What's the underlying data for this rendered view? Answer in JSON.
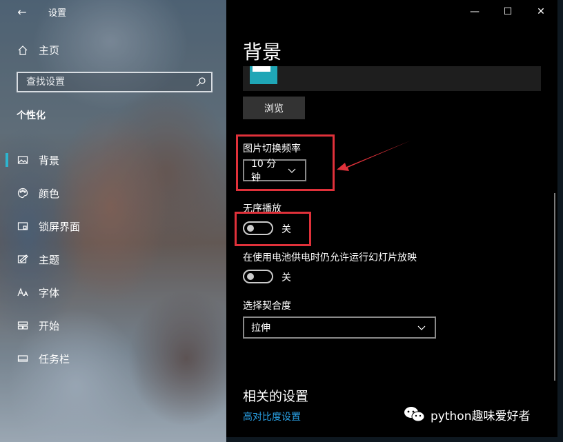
{
  "window": {
    "title": "设置",
    "back": "←",
    "minimize": "—",
    "maximize": "☐",
    "close": "✕"
  },
  "sidebar": {
    "home_label": "主页",
    "search_placeholder": "查找设置",
    "section_title": "个性化",
    "items": [
      {
        "label": "背景",
        "icon": "picture-icon",
        "active": true
      },
      {
        "label": "颜色",
        "icon": "palette-icon"
      },
      {
        "label": "锁屏界面",
        "icon": "lock-screen-icon"
      },
      {
        "label": "主题",
        "icon": "theme-icon"
      },
      {
        "label": "字体",
        "icon": "font-icon"
      },
      {
        "label": "开始",
        "icon": "start-icon"
      },
      {
        "label": "任务栏",
        "icon": "taskbar-icon"
      }
    ]
  },
  "main": {
    "title": "背景",
    "browse_label": "浏览",
    "change_interval_label": "图片切换频率",
    "change_interval_value": "10 分钟",
    "shuffle_label": "无序播放",
    "shuffle_state": "关",
    "battery_label": "在使用电池供电时仍允许运行幻灯片放映",
    "battery_state": "关",
    "fit_label": "选择契合度",
    "fit_value": "拉伸",
    "related_title": "相关的设置",
    "contrast_link": "高对比度设置"
  },
  "colors": {
    "accent": "#2db5cf",
    "link": "#2aa3e8",
    "annotation": "#e0313a"
  },
  "watermark": "python趣味爱好者"
}
